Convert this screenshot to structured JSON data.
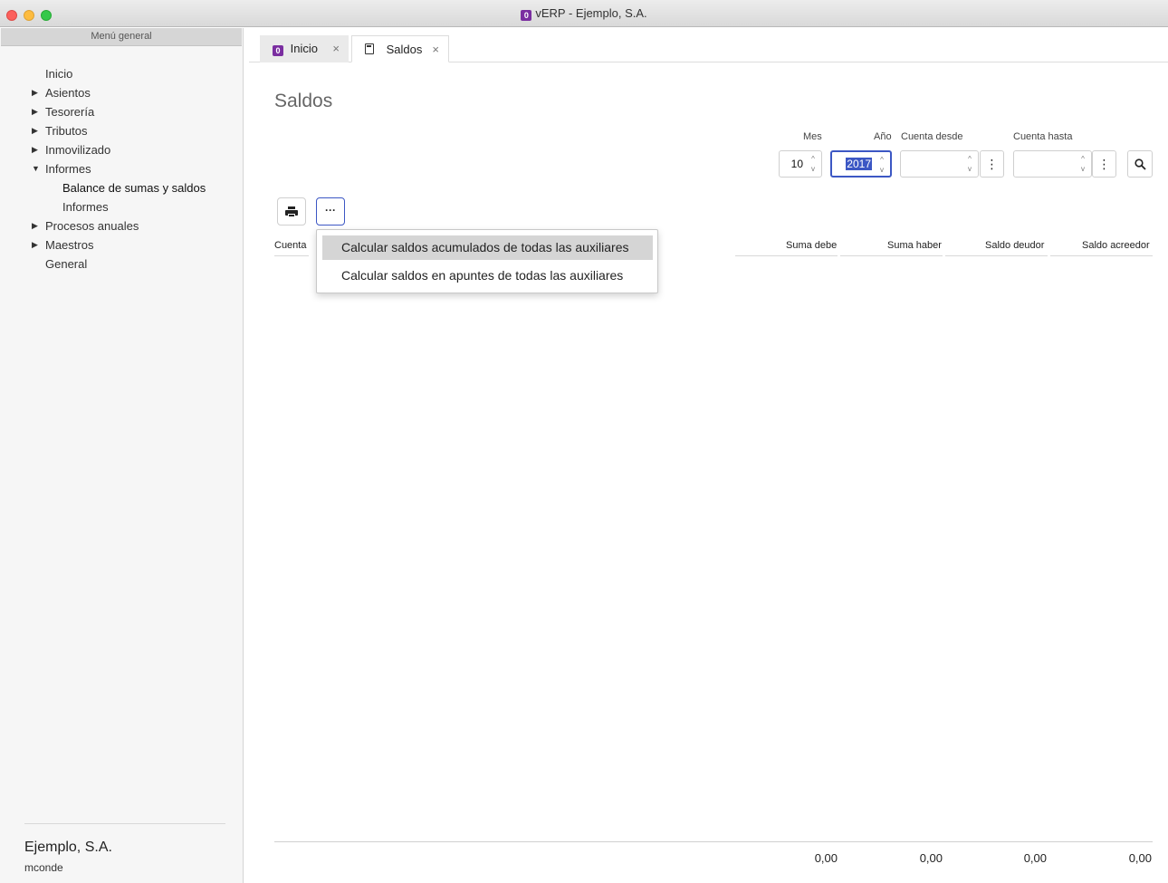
{
  "window": {
    "title": "vERP - Ejemplo, S.A.",
    "app_badge": "0"
  },
  "sidebar": {
    "header": "Menú general",
    "items": [
      {
        "label": "Inicio",
        "caret": ""
      },
      {
        "label": "Asientos",
        "caret": "▶"
      },
      {
        "label": "Tesorería",
        "caret": "▶"
      },
      {
        "label": "Tributos",
        "caret": "▶"
      },
      {
        "label": "Inmovilizado",
        "caret": "▶"
      },
      {
        "label": "Informes",
        "caret": "▼"
      },
      {
        "label": "Balance de sumas y saldos",
        "caret": ""
      },
      {
        "label": "Informes",
        "caret": ""
      },
      {
        "label": "Procesos anuales",
        "caret": "▶"
      },
      {
        "label": "Maestros",
        "caret": "▶"
      },
      {
        "label": "General",
        "caret": ""
      }
    ],
    "company": "Ejemplo, S.A.",
    "user": "mconde"
  },
  "tabs": [
    {
      "label": "Inicio",
      "icon": "0",
      "close": "×"
    },
    {
      "label": "Saldos",
      "close": "×"
    }
  ],
  "page": {
    "title": "Saldos"
  },
  "filters": {
    "mes_label": "Mes",
    "mes_value": "10",
    "anio_label": "Año",
    "anio_value": "2017",
    "cuenta_desde_label": "Cuenta desde",
    "cuenta_desde_value": "",
    "cuenta_hasta_label": "Cuenta hasta",
    "cuenta_hasta_value": "",
    "more_glyph": "⋮",
    "search_glyph": "⚲",
    "spin_up": "^",
    "spin_down": "v"
  },
  "toolbar": {
    "more_label": "···"
  },
  "dropdown": {
    "items": [
      "Calcular saldos acumulados de todas las auxiliares",
      "Calcular saldos en apuntes de todas las auxiliares"
    ]
  },
  "table": {
    "columns": [
      "Cuenta",
      "Suma debe",
      "Suma haber",
      "Saldo deudor",
      "Saldo acreedor"
    ],
    "totals": [
      "0,00",
      "0,00",
      "0,00",
      "0,00"
    ]
  }
}
